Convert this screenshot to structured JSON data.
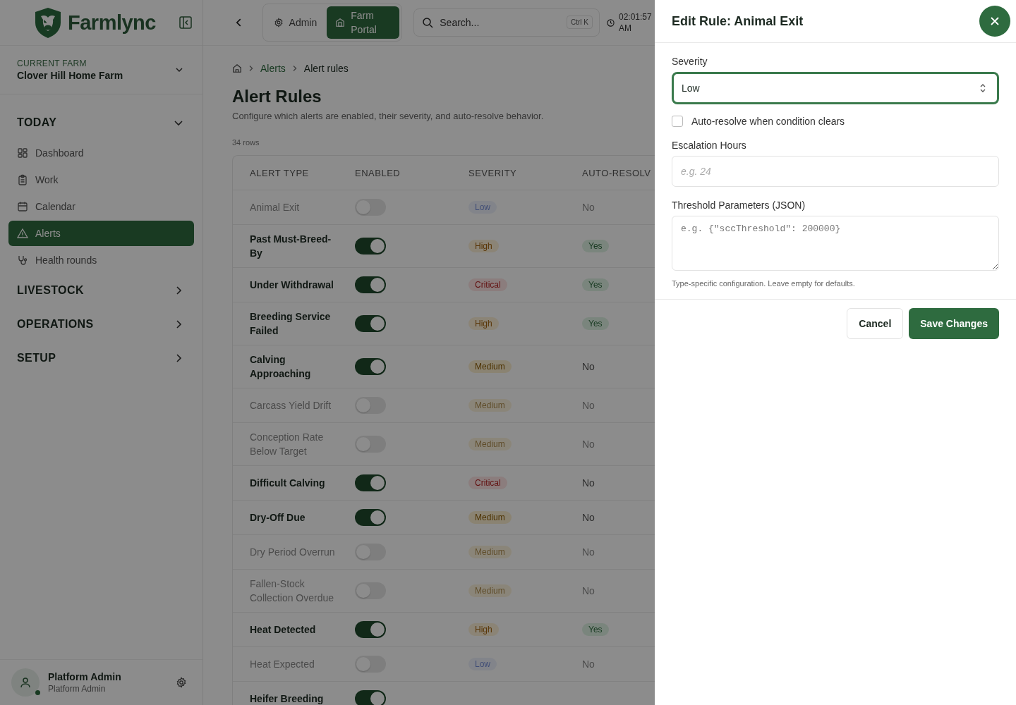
{
  "app": {
    "name": "Farmlync"
  },
  "header": {
    "modes": [
      {
        "label": "Admin",
        "selected": false
      },
      {
        "label": "Farm Portal",
        "selected": true
      }
    ],
    "search": {
      "placeholder": "Search...",
      "shortcut": "Ctrl K"
    },
    "time": "02:01:57 AM"
  },
  "sidebar": {
    "farm": {
      "label": "CURRENT FARM",
      "name": "Clover Hill Home Farm"
    },
    "groups": [
      {
        "label": "TODAY",
        "expanded": true,
        "items": [
          {
            "label": "Dashboard",
            "selected": false
          },
          {
            "label": "Work",
            "selected": false
          },
          {
            "label": "Calendar",
            "selected": false
          },
          {
            "label": "Alerts",
            "selected": true
          },
          {
            "label": "Health rounds",
            "selected": false
          }
        ]
      },
      {
        "label": "LIVESTOCK",
        "expanded": false
      },
      {
        "label": "OPERATIONS",
        "expanded": false
      },
      {
        "label": "SETUP",
        "expanded": false
      }
    ],
    "user": {
      "name": "Platform Admin",
      "role": "Platform Admin",
      "online": true
    }
  },
  "breadcrumb": [
    "Alerts",
    "Alert rules"
  ],
  "page": {
    "title": "Alert Rules",
    "subtitle": "Configure which alerts are enabled, their severity, and auto-resolve behavior.",
    "row_count": "34 rows"
  },
  "table": {
    "columns": [
      "ALERT TYPE",
      "ENABLED",
      "SEVERITY",
      "AUTO-RESOLV"
    ],
    "rows": [
      {
        "type": "Animal Exit",
        "enabled": false,
        "severity": {
          "text": "Low",
          "kind": "low"
        },
        "auto_resolve": {
          "text": "No",
          "on": false
        }
      },
      {
        "type": "Past Must-Breed-By",
        "enabled": true,
        "severity": {
          "text": "High",
          "kind": "high"
        },
        "auto_resolve": {
          "text": "Yes",
          "on": true
        }
      },
      {
        "type": "Under Withdrawal",
        "enabled": true,
        "severity": {
          "text": "Critical",
          "kind": "critical"
        },
        "auto_resolve": {
          "text": "Yes",
          "on": true
        }
      },
      {
        "type": "Breeding Service Failed",
        "enabled": true,
        "severity": {
          "text": "High",
          "kind": "high"
        },
        "auto_resolve": {
          "text": "Yes",
          "on": true
        }
      },
      {
        "type": "Calving Approaching",
        "enabled": true,
        "severity": {
          "text": "Medium",
          "kind": "medium"
        },
        "auto_resolve": {
          "text": "No",
          "on": false
        }
      },
      {
        "type": "Carcass Yield Drift",
        "enabled": false,
        "severity": {
          "text": "Medium",
          "kind": "medium"
        },
        "auto_resolve": {
          "text": "No",
          "on": false
        }
      },
      {
        "type": "Conception Rate Below Target",
        "enabled": false,
        "severity": {
          "text": "Medium",
          "kind": "medium"
        },
        "auto_resolve": {
          "text": "No",
          "on": false
        }
      },
      {
        "type": "Difficult Calving",
        "enabled": true,
        "severity": {
          "text": "Critical",
          "kind": "critical"
        },
        "auto_resolve": {
          "text": "No",
          "on": false
        }
      },
      {
        "type": "Dry-Off Due",
        "enabled": true,
        "severity": {
          "text": "Medium",
          "kind": "medium"
        },
        "auto_resolve": {
          "text": "No",
          "on": false
        }
      },
      {
        "type": "Dry Period Overrun",
        "enabled": false,
        "severity": {
          "text": "Medium",
          "kind": "medium"
        },
        "auto_resolve": {
          "text": "No",
          "on": false
        }
      },
      {
        "type": "Fallen-Stock Collection Overdue",
        "enabled": false,
        "severity": {
          "text": "Medium",
          "kind": "medium"
        },
        "auto_resolve": {
          "text": "No",
          "on": false
        }
      },
      {
        "type": "Heat Detected",
        "enabled": true,
        "severity": {
          "text": "High",
          "kind": "high"
        },
        "auto_resolve": {
          "text": "Yes",
          "on": true
        }
      },
      {
        "type": "Heat Expected",
        "enabled": false,
        "severity": {
          "text": "Low",
          "kind": "low"
        },
        "auto_resolve": {
          "text": "No",
          "on": false
        }
      },
      {
        "type": "Heifer Breeding",
        "enabled": true
      }
    ]
  },
  "drawer": {
    "title": "Edit Rule: Animal Exit",
    "severity": {
      "label": "Severity",
      "value": "Low"
    },
    "auto_resolve": {
      "label": "Auto-resolve when condition clears",
      "checked": false
    },
    "escalation": {
      "label": "Escalation Hours",
      "placeholder": "e.g. 24"
    },
    "threshold": {
      "label": "Threshold Parameters (JSON)",
      "placeholder": "e.g. {\"sccThreshold\": 200000}",
      "hint": "Type-specific configuration. Leave empty for defaults."
    },
    "buttons": [
      {
        "label": "Cancel",
        "kind": "secondary"
      },
      {
        "label": "Save Changes",
        "kind": "primary"
      }
    ]
  }
}
